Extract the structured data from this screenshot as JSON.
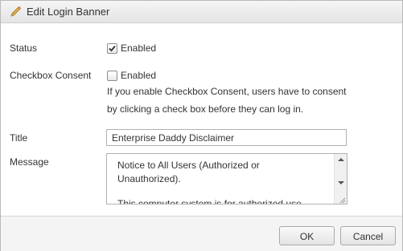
{
  "dialog": {
    "title": "Edit Login Banner"
  },
  "form": {
    "status": {
      "label": "Status",
      "checkbox_label": "Enabled",
      "checked": true
    },
    "checkbox_consent": {
      "label": "Checkbox Consent",
      "checkbox_label": "Enabled",
      "checked": false,
      "help_line1": "If you enable Checkbox Consent, users have to consent",
      "help_line2": "by clicking a check box before they can log in."
    },
    "title_field": {
      "label": "Title",
      "value": "Enterprise Daddy Disclaimer"
    },
    "message_field": {
      "label": "Message",
      "line1": "Notice to All Users (Authorized or",
      "line2": "Unauthorized).",
      "line3": "This computer system is for authorized use"
    }
  },
  "buttons": {
    "ok": "OK",
    "cancel": "Cancel"
  }
}
